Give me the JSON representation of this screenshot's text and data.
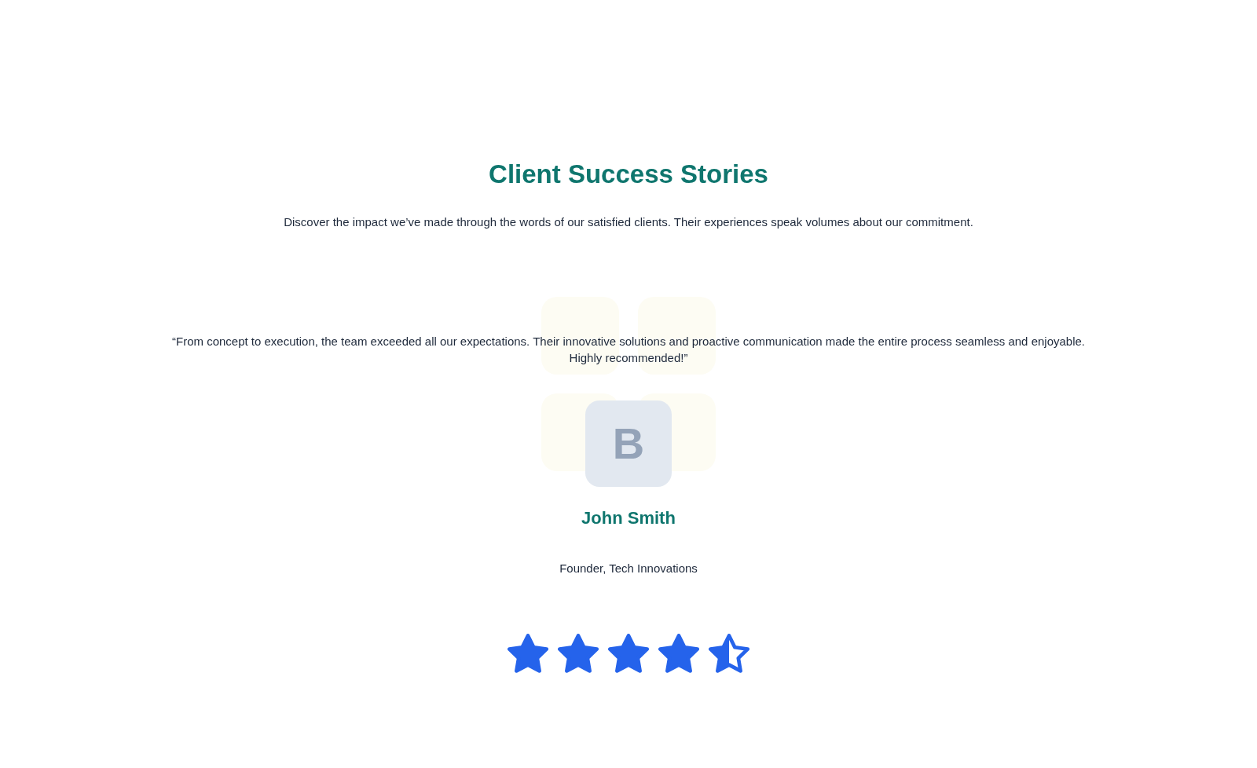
{
  "section": {
    "title": "Client Success Stories",
    "subtitle": "Discover the impact we’ve made through the words of our satisfied clients. Their experiences speak volumes about our commitment."
  },
  "testimonial": {
    "quote": "“From concept to execution, the team exceeded all our expectations. Their innovative solutions and proactive communication made the entire process seamless and enjoyable. Highly recommended!”",
    "avatar": {
      "initial": "B"
    },
    "name": "John Smith",
    "role": "Founder, Tech Innovations",
    "rating": {
      "stars": 4.5
    }
  }
}
